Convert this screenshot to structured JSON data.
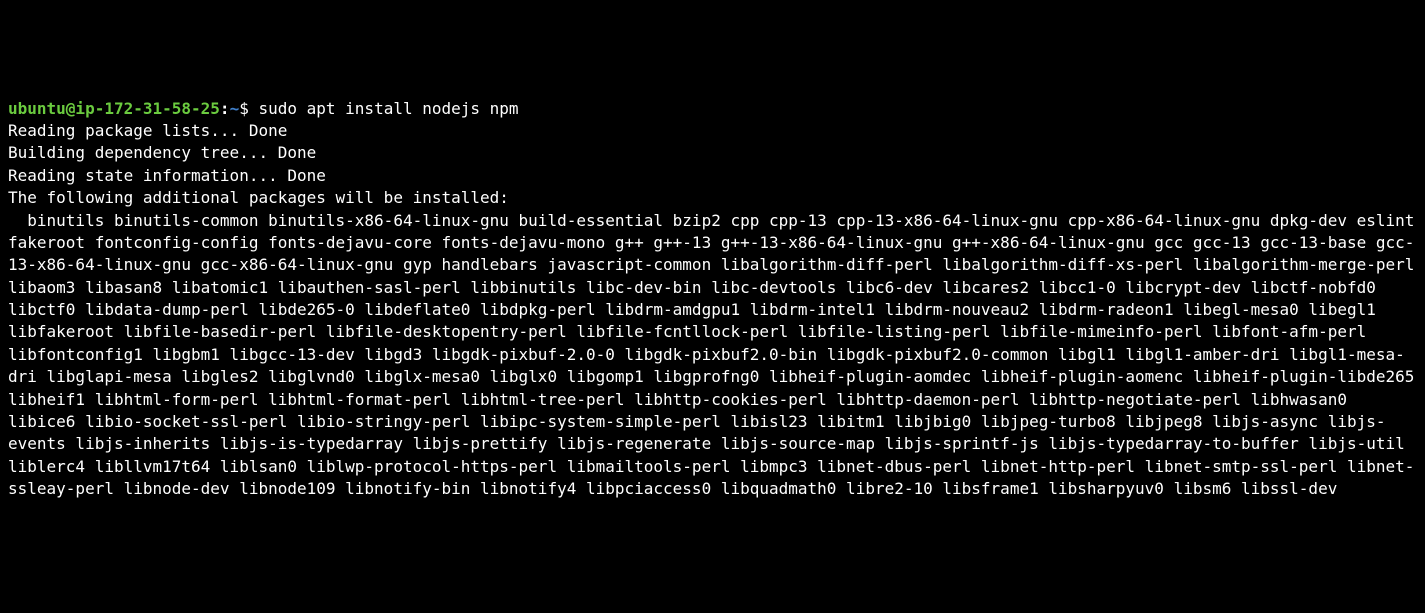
{
  "prompt": {
    "user_host": "ubuntu@ip-172-31-58-25",
    "colon": ":",
    "path": "~",
    "dollar": "$ ",
    "command": "sudo apt install nodejs npm"
  },
  "output": {
    "lines": [
      "Reading package lists... Done",
      "Building dependency tree... Done",
      "Reading state information... Done",
      "The following additional packages will be installed:"
    ],
    "packages": "  binutils binutils-common binutils-x86-64-linux-gnu build-essential bzip2 cpp cpp-13 cpp-13-x86-64-linux-gnu cpp-x86-64-linux-gnu dpkg-dev eslint fakeroot fontconfig-config fonts-dejavu-core fonts-dejavu-mono g++ g++-13 g++-13-x86-64-linux-gnu g++-x86-64-linux-gnu gcc gcc-13 gcc-13-base gcc-13-x86-64-linux-gnu gcc-x86-64-linux-gnu gyp handlebars javascript-common libalgorithm-diff-perl libalgorithm-diff-xs-perl libalgorithm-merge-perl libaom3 libasan8 libatomic1 libauthen-sasl-perl libbinutils libc-dev-bin libc-devtools libc6-dev libcares2 libcc1-0 libcrypt-dev libctf-nobfd0 libctf0 libdata-dump-perl libde265-0 libdeflate0 libdpkg-perl libdrm-amdgpu1 libdrm-intel1 libdrm-nouveau2 libdrm-radeon1 libegl-mesa0 libegl1 libfakeroot libfile-basedir-perl libfile-desktopentry-perl libfile-fcntllock-perl libfile-listing-perl libfile-mimeinfo-perl libfont-afm-perl libfontconfig1 libgbm1 libgcc-13-dev libgd3 libgdk-pixbuf-2.0-0 libgdk-pixbuf2.0-bin libgdk-pixbuf2.0-common libgl1 libgl1-amber-dri libgl1-mesa-dri libglapi-mesa libgles2 libglvnd0 libglx-mesa0 libglx0 libgomp1 libgprofng0 libheif-plugin-aomdec libheif-plugin-aomenc libheif-plugin-libde265 libheif1 libhtml-form-perl libhtml-format-perl libhtml-tree-perl libhttp-cookies-perl libhttp-daemon-perl libhttp-negotiate-perl libhwasan0 libice6 libio-socket-ssl-perl libio-stringy-perl libipc-system-simple-perl libisl23 libitm1 libjbig0 libjpeg-turbo8 libjpeg8 libjs-async libjs-events libjs-inherits libjs-is-typedarray libjs-prettify libjs-regenerate libjs-source-map libjs-sprintf-js libjs-typedarray-to-buffer libjs-util liblerc4 libllvm17t64 liblsan0 liblwp-protocol-https-perl libmailtools-perl libmpc3 libnet-dbus-perl libnet-http-perl libnet-smtp-ssl-perl libnet-ssleay-perl libnode-dev libnode109 libnotify-bin libnotify4 libpciaccess0 libquadmath0 libre2-10 libsframe1 libsharpyuv0 libsm6 libssl-dev"
  }
}
